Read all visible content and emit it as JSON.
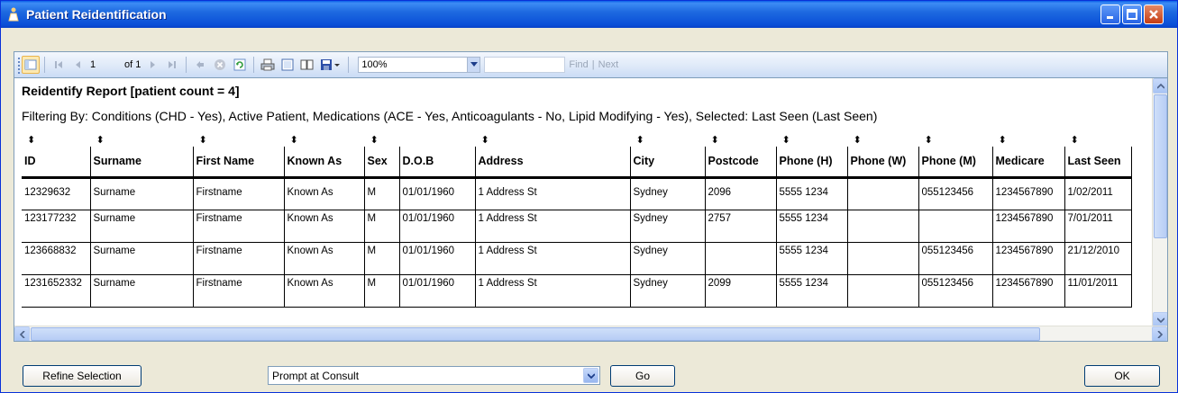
{
  "window": {
    "title": "Patient Reidentification"
  },
  "toolbar": {
    "page_value": "1",
    "of_text": "of 1",
    "zoom": "100%",
    "find_label": "Find",
    "next_label": "Next",
    "find_separator": "|"
  },
  "report": {
    "title": "Reidentify Report  [patient count = 4]",
    "filter": "Filtering By: Conditions (CHD - Yes), Active Patient, Medications (ACE - Yes, Anticoagulants - No, Lipid Modifying - Yes), Selected: Last Seen (Last Seen)",
    "sort_glyph": "⬍",
    "columns": [
      "ID",
      "Surname",
      "First Name",
      "Known As",
      "Sex",
      "D.O.B",
      "Address",
      "City",
      "Postcode",
      "Phone (H)",
      "Phone (W)",
      "Phone (M)",
      "Medicare",
      "Last Seen"
    ],
    "rows": [
      [
        "12329632",
        "Surname",
        "Firstname",
        "Known As",
        "M",
        "01/01/1960",
        "1 Address St",
        "Sydney",
        "2096",
        "5555 1234",
        "",
        "055123456",
        "1234567890",
        "1/02/2011"
      ],
      [
        "123177232",
        "Surname",
        "Firstname",
        "Known As",
        "M",
        "01/01/1960",
        "1 Address St",
        "Sydney",
        "2757",
        "5555 1234",
        "",
        "",
        "1234567890",
        "7/01/2011"
      ],
      [
        "123668832",
        "Surname",
        "Firstname",
        "Known As",
        "M",
        "01/01/1960",
        "1 Address St",
        "Sydney",
        "",
        "5555 1234",
        "",
        "055123456",
        "1234567890",
        "21/12/2010"
      ],
      [
        "1231652332",
        "Surname",
        "Firstname",
        "Known As",
        "M",
        "01/01/1960",
        "1 Address St",
        "Sydney",
        "2099",
        "5555 1234",
        "",
        "055123456",
        "1234567890",
        "11/01/2011"
      ]
    ]
  },
  "bottom": {
    "refine_label": "Refine Selection",
    "combo_value": "Prompt at Consult",
    "go_label": "Go",
    "ok_label": "OK"
  },
  "colors": {
    "titlebar": "#0a4fd8",
    "border": "#7f9db9",
    "face": "#ece9d8"
  }
}
